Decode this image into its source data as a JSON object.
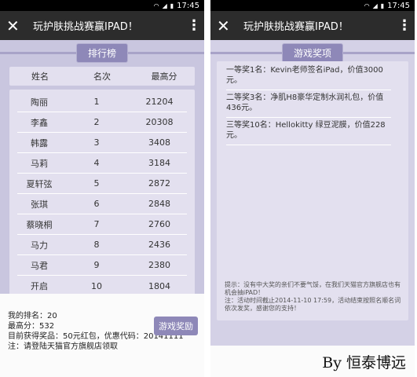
{
  "status_bar": {
    "time": "17:45"
  },
  "left": {
    "title": "玩护肤挑战赛赢IPAD！",
    "section_title": "排行榜",
    "columns": [
      "姓名",
      "名次",
      "最高分"
    ],
    "rows": [
      {
        "name": "陶丽",
        "rank": "1",
        "score": "21204"
      },
      {
        "name": "李鑫",
        "rank": "2",
        "score": "20308"
      },
      {
        "name": "韩露",
        "rank": "3",
        "score": "3408"
      },
      {
        "name": "马莉",
        "rank": "4",
        "score": "3184"
      },
      {
        "name": "夏轩弦",
        "rank": "5",
        "score": "2872"
      },
      {
        "name": "张琪",
        "rank": "6",
        "score": "2848"
      },
      {
        "name": "蔡晓桐",
        "rank": "7",
        "score": "2760"
      },
      {
        "name": "马力",
        "rank": "8",
        "score": "2436"
      },
      {
        "name": "马君",
        "rank": "9",
        "score": "2380"
      },
      {
        "name": "开启",
        "rank": "10",
        "score": "1804"
      }
    ],
    "footer": {
      "my_rank": "我的排名：20",
      "best_score": "最高分：532",
      "prize": "目前获得奖品：50元红包，优惠代码：20141111",
      "note": "注：请登陆天猫官方旗舰店领取",
      "prize_button": "游戏奖励"
    }
  },
  "right": {
    "title": "玩护肤挑战赛赢IPAD！",
    "section_title": "游戏奖项",
    "prizes": [
      "一等奖1名：Kevin老师签名iPad，价值3000元。",
      "二等奖3名：净肌H8豪华定制水润礼包，价值436元。",
      "三等奖10名：Hellokitty 绿豆泥膜，价值228元。"
    ],
    "notice": [
      "提示：没有中大奖的亲们不要气馁，在我们天猫官方旗舰店也有机会抽iPAD！",
      "注：活动时间截止2014-11-10 17:59，活动结束按照名顺名词依次发奖，感谢您的支持！"
    ],
    "credit": "By 恒泰博远"
  }
}
